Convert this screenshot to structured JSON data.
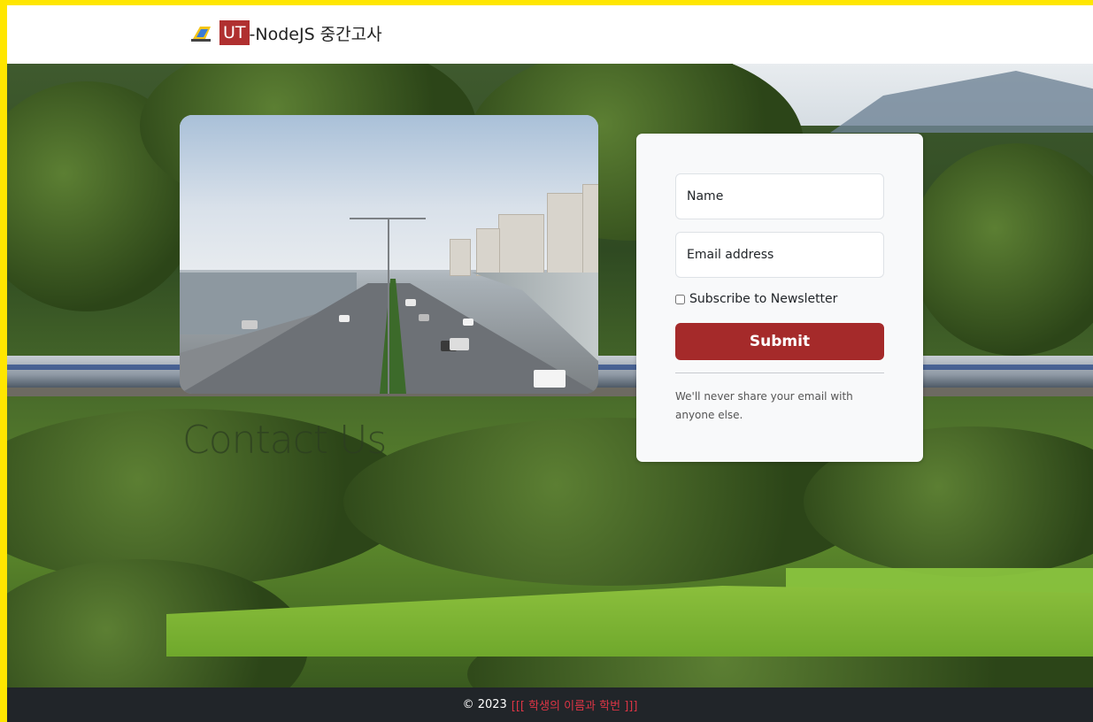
{
  "navbar": {
    "brand_badge": "UT",
    "brand_text": "-NodeJS 중간고사",
    "brand_icon": "train-logo-icon"
  },
  "hero": {
    "contact_title": "Contact Us"
  },
  "form": {
    "name_placeholder": "Name",
    "email_placeholder": "Email address",
    "subscribe_label": "Subscribe to Newsletter",
    "subscribe_checked": false,
    "submit_label": "Submit",
    "privacy_note": "We'll never share your email with anyone else."
  },
  "footer": {
    "copyright": "© 2023",
    "student_info": "[[[ 학생의 이름과 학번 ]]]"
  },
  "colors": {
    "accent": "#a52a2a",
    "brand_badge": "#b03030",
    "footer_bg": "#212529",
    "footer_highlight": "#dc3545",
    "page_border": "#ffe600"
  }
}
